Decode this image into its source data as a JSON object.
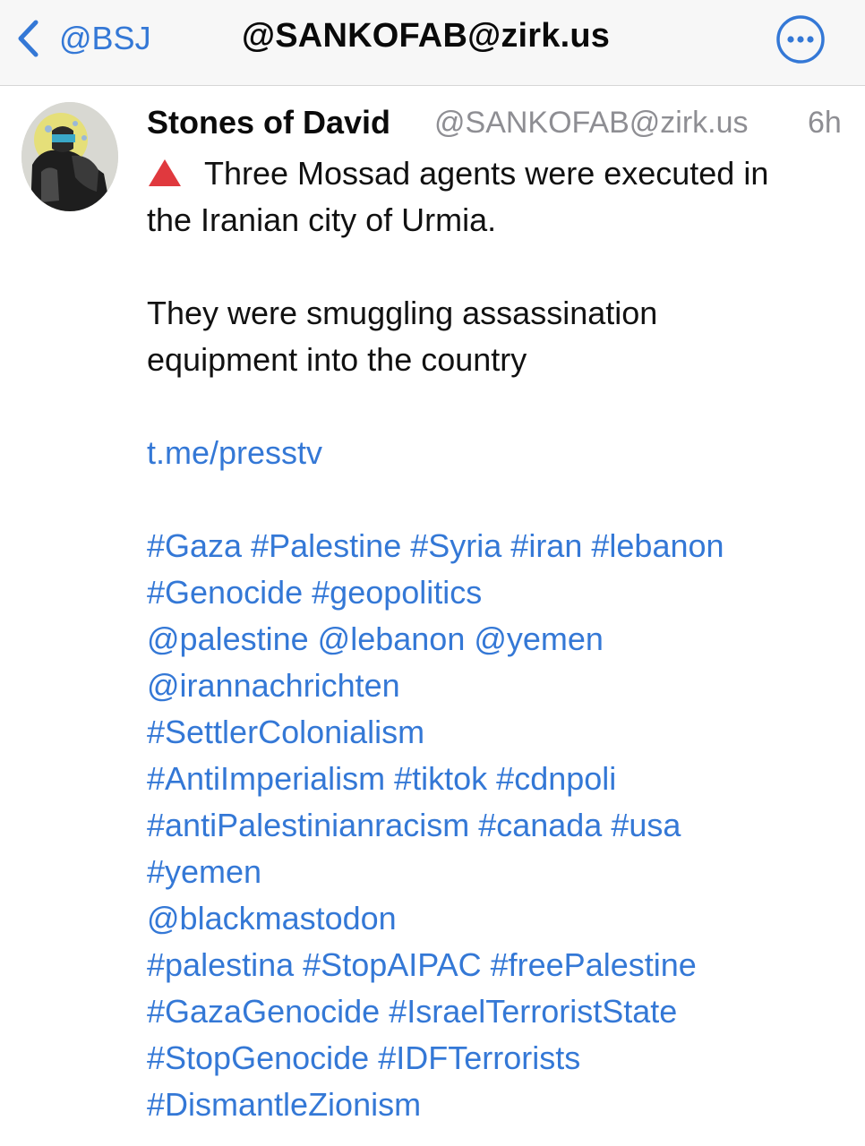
{
  "navbar": {
    "back_label": "@BSJ",
    "title": "@SANKOFAB@zirk.us"
  },
  "post": {
    "author_name": "Stones of David",
    "author_handle": "@SANKOFAB@zirk.us",
    "timestamp": "6h",
    "line1": "Three Mossad agents were executed in",
    "line2": "the Iranian city of Urmia.",
    "line3": "They were smuggling assassination",
    "line4": "equipment into the country",
    "link": "t.me/presstv",
    "tag_lines": [
      [
        "#Gaza",
        "#Palestine",
        "#Syria",
        "#iran",
        "#lebanon"
      ],
      [
        "#Genocide",
        "#geopolitics"
      ],
      [
        "@palestine",
        "@lebanon",
        "@yemen"
      ],
      [
        "@irannachrichten"
      ],
      [
        "#SettlerColonialism"
      ],
      [
        "#AntiImperialism",
        " #tiktok",
        "#cdnpoli"
      ],
      [
        "#antiPalestinianracism",
        "#canada",
        "#usa"
      ],
      [
        "#yemen"
      ],
      [
        "@blackmastodon"
      ],
      [
        "#palestina",
        "#StopAIPAC",
        "#freePalestine"
      ],
      [
        "#GazaGenocide",
        "#IsraelTerroristState"
      ],
      [
        "#StopGenocide",
        "#IDFTerrorists"
      ],
      [
        "#DismantleZionism"
      ]
    ]
  },
  "icons": {
    "back": "chevron-left-icon",
    "more": "ellipsis-circle-icon",
    "warning": "red-triangle-icon"
  },
  "colors": {
    "accent": "#3478d6",
    "warning": "#e0393e",
    "secondary_text": "#8e8e93"
  }
}
